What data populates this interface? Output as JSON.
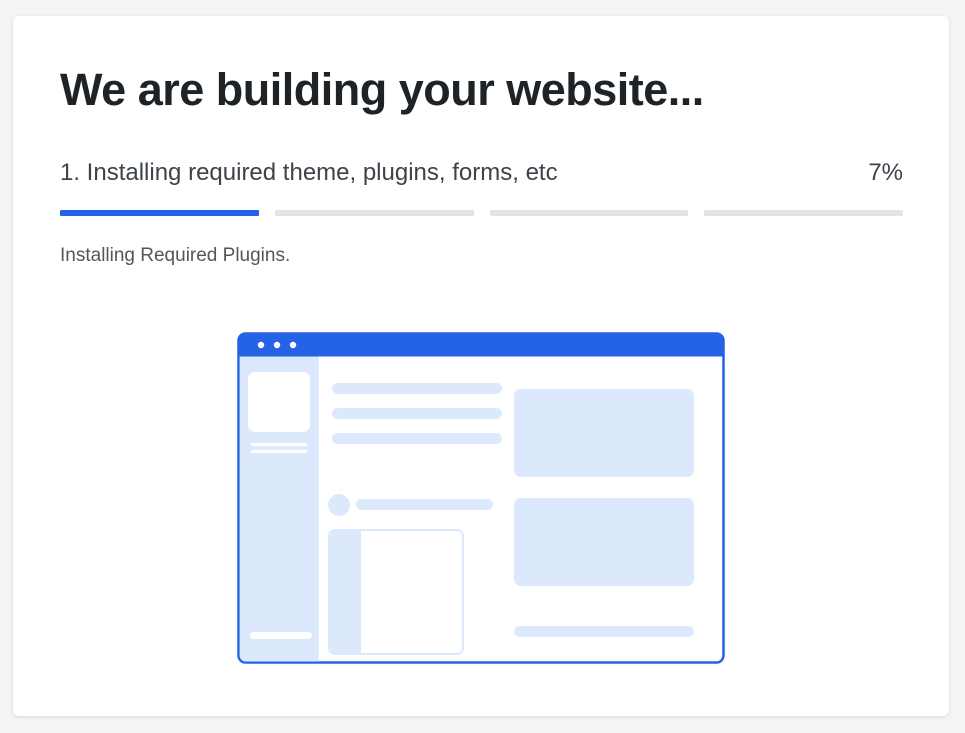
{
  "header": {
    "title": "We are building your website..."
  },
  "step": {
    "label": "1. Installing required theme, plugins, forms, etc",
    "percent_text": "7%"
  },
  "progress": {
    "segments": [
      1.0,
      0.0,
      0.0,
      0.0
    ]
  },
  "status": {
    "message": "Installing Required Plugins."
  },
  "colors": {
    "accent": "#2563e6",
    "track": "#e4e4e7",
    "illustration_fill": "#dce9fd",
    "title": "#1d2327"
  },
  "illustration": {
    "icon": "website-builder-illustration"
  }
}
